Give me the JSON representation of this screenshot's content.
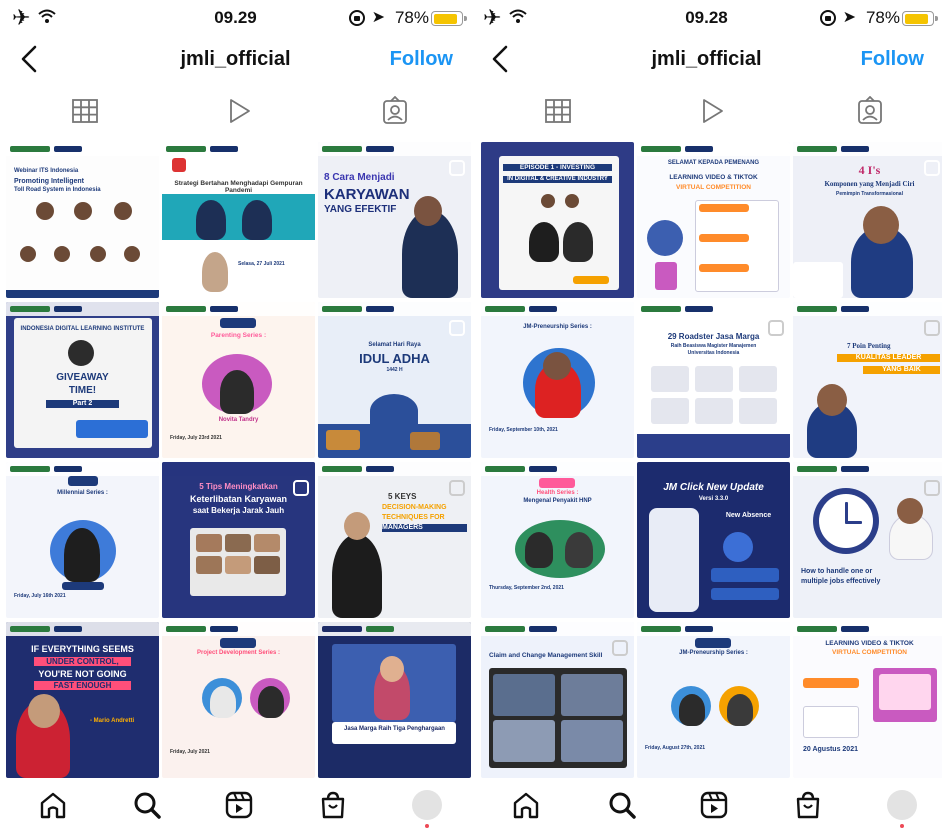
{
  "phones": [
    {
      "status": {
        "time": "09.29",
        "battery": "78%",
        "battery_level": 0.78
      },
      "header": {
        "username": "jmli_official",
        "follow": "Follow"
      },
      "posts": [
        {
          "title": "Webinar ITS Indonesia",
          "lines": [
            "Promoting Intelligent",
            "Toll Road System in Indonesia"
          ]
        },
        {
          "title": "Strategi Bertahan Menghadapi Gempuran Pandemi",
          "date": "Selasa, 27 Juli 2021"
        },
        {
          "title": "8 Cara Menjadi",
          "lines": [
            "KARYAWAN",
            "YANG EFEKTIF"
          ]
        },
        {
          "title": "INDONESIA DIGITAL LEARNING INSTITUTE",
          "lines": [
            "GIVEAWAY",
            "TIME!",
            "Part 2"
          ]
        },
        {
          "title": "Parenting Series :",
          "lines": [
            "Novita Tandry"
          ],
          "date": "Friday, July 23rd 2021"
        },
        {
          "title": "Selamat Hari Raya",
          "lines": [
            "IDUL ADHA",
            "1442 H"
          ]
        },
        {
          "title": "JM TALK",
          "lines": [
            "Millennial Series :"
          ],
          "date": "Friday, July 16th 2021"
        },
        {
          "title": "5 Tips Meningkatkan",
          "lines": [
            "Keterlibatan Karyawan",
            "saat Bekerja Jarak Jauh"
          ]
        },
        {
          "title": "5 KEYS",
          "lines": [
            "DECISION-MAKING",
            "TECHNIQUES FOR",
            "MANAGERS"
          ]
        },
        {
          "title": "IF EVERYTHING SEEMS",
          "lines": [
            "UNDER CONTROL,",
            "YOU'RE NOT GOING",
            "FAST ENOUGH",
            "- Mario Andretti"
          ]
        },
        {
          "title": "Project Development Series :",
          "date": "Friday, July 2021"
        },
        {
          "title": "Jasa Marga Raih Tiga Penghargaan"
        }
      ]
    },
    {
      "status": {
        "time": "09.28",
        "battery": "78%",
        "battery_level": 0.78
      },
      "header": {
        "username": "jmli_official",
        "follow": "Follow"
      },
      "posts": [
        {
          "title": "EPISODE 1 - INVESTING",
          "lines": [
            "IN DIGITAL & CREATIVE INDUSTRY"
          ]
        },
        {
          "title": "SELAMAT KEPADA PEMENANG",
          "lines": [
            "LEARNING VIDEO & TIKTOK",
            "VIRTUAL COMPETITION"
          ]
        },
        {
          "title": "4 I's",
          "lines": [
            "Komponen yang Menjadi Ciri",
            "Pemimpin Transformasional"
          ]
        },
        {
          "title": "JM-Preneurship Series :",
          "date": "Friday, September 10th, 2021"
        },
        {
          "title": "29 Roadster Jasa Marga",
          "lines": [
            "Raih Beasiswa Magister Manajemen",
            "Universitas Indonesia"
          ]
        },
        {
          "title": "7 Poin Penting",
          "lines": [
            "KUALITAS LEADER",
            "YANG BAIK"
          ]
        },
        {
          "title": "Health Series :",
          "lines": [
            "Mengenal Penyakit HNP"
          ],
          "date": "Thursday, September 2nd, 2021"
        },
        {
          "title": "JM Click New Update",
          "lines": [
            "Versi 3.3.0",
            "New Absence"
          ]
        },
        {
          "title": "How to handle one or",
          "lines": [
            "multiple jobs effectively"
          ]
        },
        {
          "title": "Claim and Change Management Skill"
        },
        {
          "title": "JM-Preneurship Series :",
          "date": "Friday, August 27th, 2021"
        },
        {
          "title": "LEARNING VIDEO & TIKTOK",
          "lines": [
            "VIRTUAL COMPETITION",
            "20 Agustus 2021"
          ]
        }
      ]
    }
  ],
  "icons": {
    "tabs": [
      "grid-icon",
      "reels-play-icon",
      "tagged-user-icon"
    ],
    "nav": [
      "home-icon",
      "search-icon",
      "reels-icon",
      "shop-icon",
      "profile-avatar"
    ]
  },
  "colors": {
    "follow": "#1b95f4",
    "battery": "#f5c400",
    "notification": "#ed4956"
  }
}
